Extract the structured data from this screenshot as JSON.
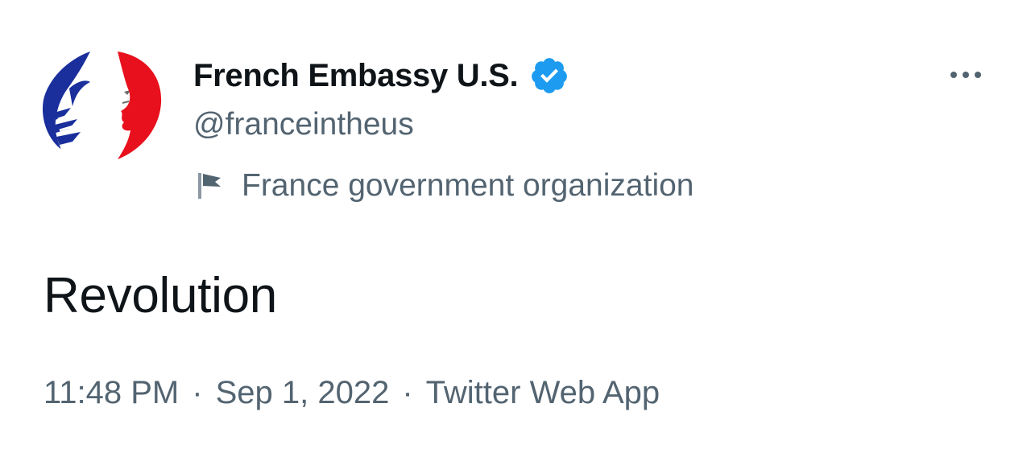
{
  "author": {
    "display_name": "French Embassy U.S.",
    "handle": "@franceintheus",
    "verified": true,
    "affiliation_label": "France government organization",
    "avatar_icon": "marianne-logo-icon",
    "verified_icon": "verified-badge-icon",
    "affiliation_icon": "flag-icon"
  },
  "tweet": {
    "text": "Revolution"
  },
  "meta": {
    "time": "11:48 PM",
    "separator": "·",
    "date": "Sep 1, 2022",
    "source": "Twitter Web App"
  },
  "actions": {
    "more_icon": "more-options-icon"
  },
  "colors": {
    "text_primary": "#0f1419",
    "text_secondary": "#536471",
    "verified_blue": "#1d9bf0",
    "logo_blue": "#1a2f9c",
    "logo_red": "#e8101d"
  }
}
